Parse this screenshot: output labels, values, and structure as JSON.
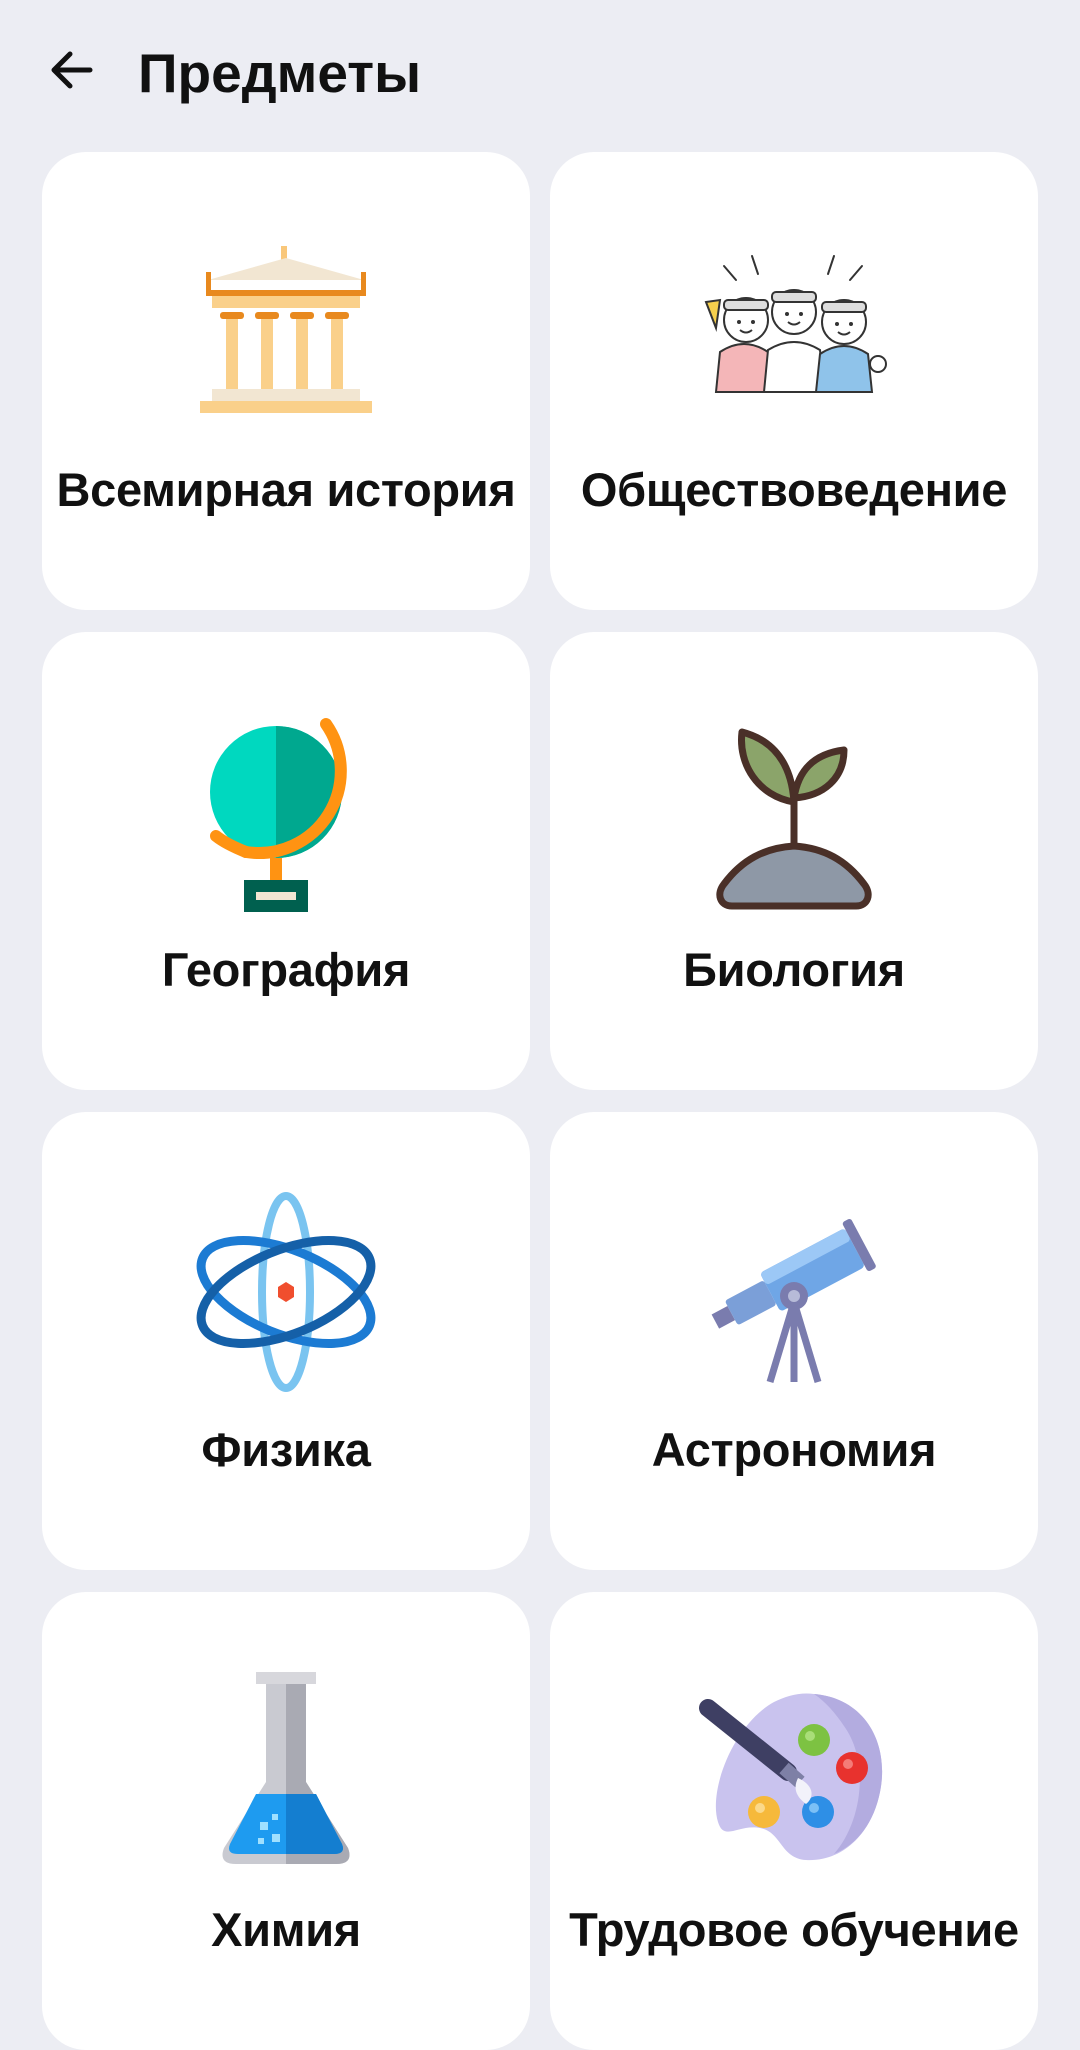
{
  "header": {
    "title": "Предметы",
    "back_icon": "arrow-left-icon"
  },
  "subjects": [
    {
      "label": "Всемирная история",
      "icon": "classical-building-icon"
    },
    {
      "label": "Обществоведение",
      "icon": "people-group-icon"
    },
    {
      "label": "География",
      "icon": "globe-icon"
    },
    {
      "label": "Биология",
      "icon": "sprout-icon"
    },
    {
      "label": "Физика",
      "icon": "atom-icon"
    },
    {
      "label": "Астрономия",
      "icon": "telescope-icon"
    },
    {
      "label": "Химия",
      "icon": "flask-icon"
    },
    {
      "label": "Трудовое обучение",
      "icon": "paint-palette-icon"
    }
  ],
  "colors": {
    "background": "#ECEDF3",
    "card": "#FFFFFF",
    "text": "#111111"
  }
}
